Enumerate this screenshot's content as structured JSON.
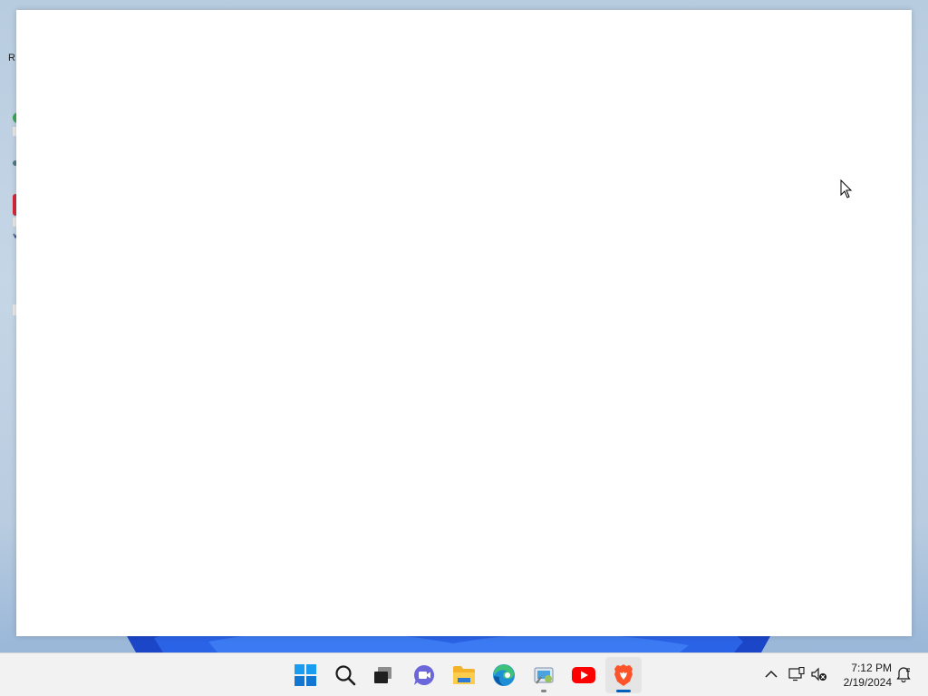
{
  "desktop": {
    "partial_label": "R"
  },
  "window": {
    "content": ""
  },
  "taskbar": {
    "apps": [
      {
        "name": "Start",
        "icon": "windows-start-icon"
      },
      {
        "name": "Search",
        "icon": "search-icon"
      },
      {
        "name": "Task View",
        "icon": "task-view-icon"
      },
      {
        "name": "Chat",
        "icon": "chat-icon"
      },
      {
        "name": "File Explorer",
        "icon": "folder-icon"
      },
      {
        "name": "Microsoft Edge",
        "icon": "edge-icon"
      },
      {
        "name": "Control Panel",
        "icon": "control-panel-icon",
        "running": true
      },
      {
        "name": "YouTube",
        "icon": "youtube-icon"
      },
      {
        "name": "Brave",
        "icon": "brave-icon",
        "active": true
      }
    ],
    "tray": {
      "overflow_icon": "chevron-up-icon",
      "network_icon": "network-icon",
      "volume_icon": "volume-muted-icon",
      "notification_icon": "notification-icon"
    },
    "clock": {
      "time": "7:12 PM",
      "date": "2/19/2024"
    }
  },
  "colors": {
    "accent": "#005fb8",
    "taskbar_bg": "#f2f2f2",
    "wallpaper_blue": "#1e50d8"
  }
}
